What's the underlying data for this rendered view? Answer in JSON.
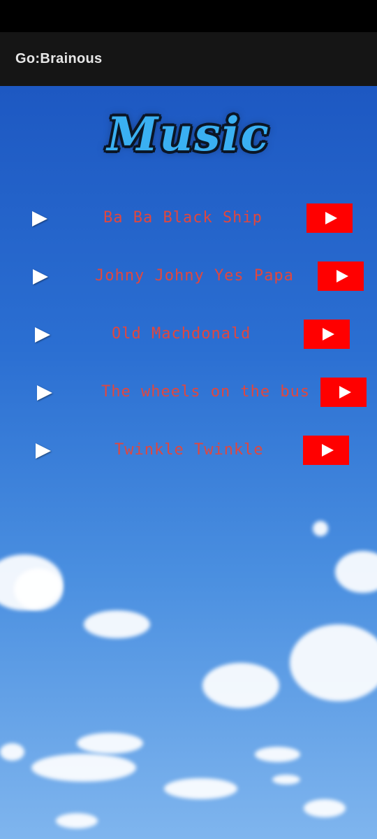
{
  "app_bar": {
    "title": "Go:Brainous"
  },
  "header": {
    "title": "Music"
  },
  "songs": [
    {
      "title": "Ba Ba Black Ship",
      "play_icon": "play-icon",
      "youtube_icon": "youtube-play-icon"
    },
    {
      "title": "Johny Johny Yes Papa",
      "play_icon": "play-icon",
      "youtube_icon": "youtube-play-icon"
    },
    {
      "title": "Old Machdonald",
      "play_icon": "play-icon",
      "youtube_icon": "youtube-play-icon"
    },
    {
      "title": "The wheels on the bus",
      "play_icon": "play-icon",
      "youtube_icon": "youtube-play-icon"
    },
    {
      "title": "Twinkle Twinkle",
      "play_icon": "play-icon",
      "youtube_icon": "youtube-play-icon"
    }
  ],
  "colors": {
    "app_bar": "#151515",
    "song_text": "#e0473f",
    "youtube_red": "#ff0000",
    "title_blue": "#3ab0f2"
  }
}
